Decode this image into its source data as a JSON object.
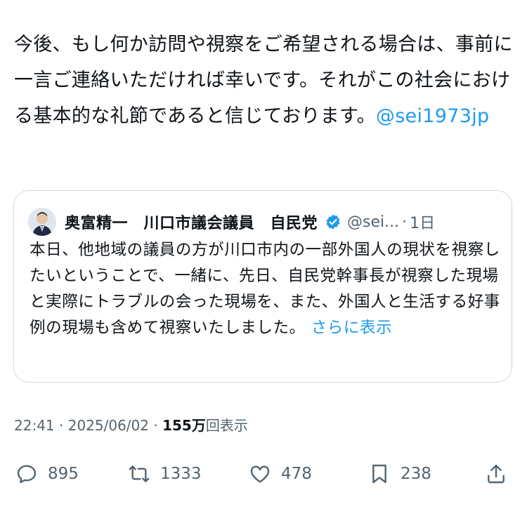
{
  "tweet": {
    "text": "今後、もし何か訪問や視察をご希望される場合は、事前に一言ご連絡いただければ幸いです。それがこの社会における基本的な礼節であると信じております。",
    "mention": "@sei1973jp"
  },
  "quote": {
    "author_name": "奥富精一　川口市議会議員　自民党",
    "handle": "@sei...",
    "separator": "·",
    "time": "1日",
    "body": "本日、他地域の議員の方が川口市内の一部外国人の現状を視察したいということで、一緒に、先日、自民党幹事長が視察した現場と実際にトラブルの会った現場を、また、外国人と生活する好事例の現場も含めて視察いたしました。",
    "show_more": "さらに表示"
  },
  "meta": {
    "time": "22:41",
    "sep1": "·",
    "date": "2025/06/02",
    "sep2": "·",
    "views_count": "155万",
    "views_label": "回表示"
  },
  "actions": {
    "replies": "895",
    "reposts": "1333",
    "likes": "478",
    "bookmarks": "238"
  },
  "colors": {
    "text": "#0f1419",
    "secondary": "#536471",
    "link": "#1d9bf0",
    "border": "#cfd9de",
    "verified": "#1d9bf0"
  },
  "icons": [
    "reply-icon",
    "repost-icon",
    "like-icon",
    "bookmark-icon",
    "share-icon",
    "verified-badge-icon"
  ]
}
